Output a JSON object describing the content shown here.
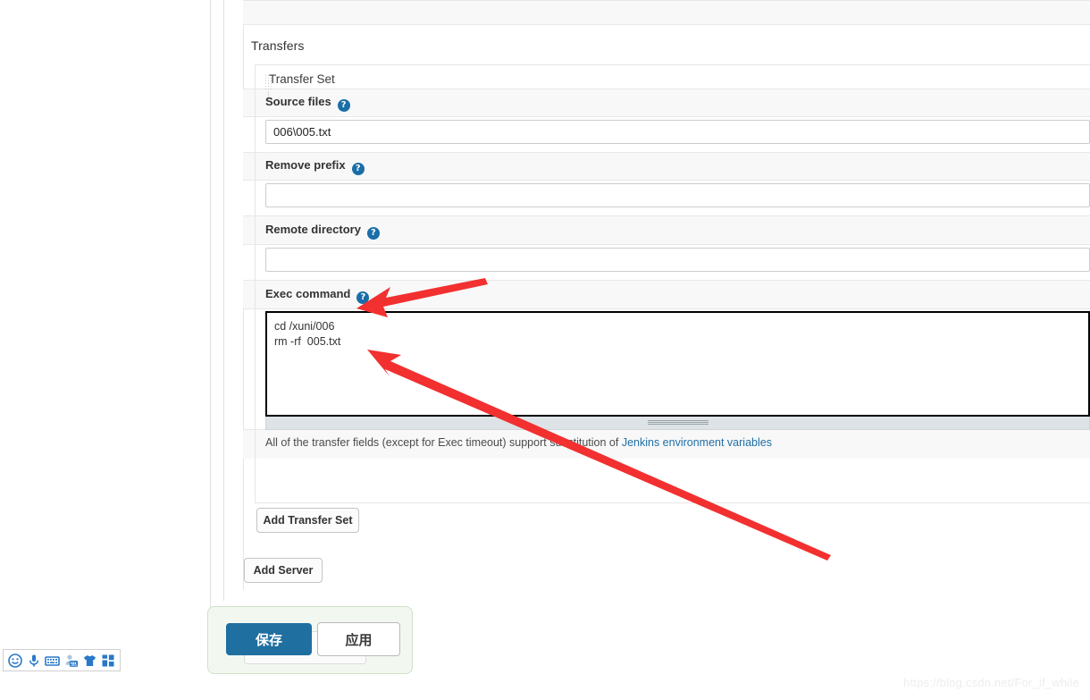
{
  "section": {
    "title": "Transfers"
  },
  "transfer_set": {
    "label": "Transfer Set",
    "grip_icon": "drag-grip-icon"
  },
  "fields": {
    "source_files": {
      "label": "Source files",
      "help_icon": "help-question-icon",
      "value": "006\\005.txt",
      "placeholder": ""
    },
    "remove_prefix": {
      "label": "Remove prefix",
      "help_icon": "help-question-icon",
      "value": "",
      "placeholder": ""
    },
    "remote_directory": {
      "label": "Remote directory",
      "help_icon": "help-question-icon",
      "value": "",
      "placeholder": ""
    },
    "exec_command": {
      "label": "Exec command",
      "help_icon": "help-question-icon",
      "value": "cd /xuni/006\nrm -rf  005.txt",
      "placeholder": ""
    }
  },
  "helper_note": {
    "text_before": "All of the transfer fields (except for Exec timeout) support substitution of ",
    "link_text": "Jenkins environment variables"
  },
  "buttons": {
    "add_transfer_set": "Add Transfer Set",
    "add_server": "Add Server",
    "save": "保存",
    "apply": "应用"
  },
  "ime_toolbar": {
    "icons": [
      "smiley-face-icon",
      "microphone-icon",
      "keyboard-icon",
      "person-2d-icon",
      "tshirt-skin-icon",
      "apps-grid-icon"
    ]
  },
  "watermark": {
    "text": "https://blog.csdn.net/For_if_while"
  },
  "colors": {
    "accent_blue": "#1f6fa1",
    "help_icon_blue": "#1a6ea8",
    "link_blue": "#1f6fa8",
    "annotation_red": "#f23030",
    "savebar_green": "#f2f8f0",
    "band_gray": "#f8f8f8"
  }
}
